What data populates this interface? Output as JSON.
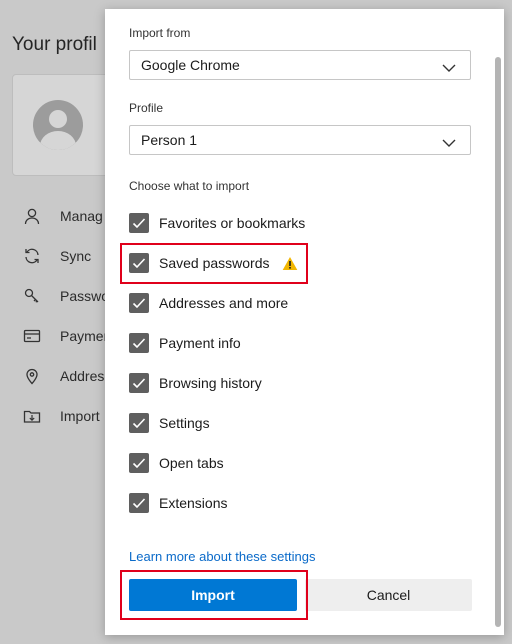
{
  "background": {
    "title": "Your profil",
    "nav_items": [
      {
        "label": "Manag",
        "icon": "person-icon"
      },
      {
        "label": "Sync",
        "icon": "sync-icon"
      },
      {
        "label": "Passwo",
        "icon": "key-icon"
      },
      {
        "label": "Paymen",
        "icon": "card-icon"
      },
      {
        "label": "Addres",
        "icon": "location-icon"
      },
      {
        "label": "Import",
        "icon": "import-icon"
      }
    ]
  },
  "dialog": {
    "import_from_label": "Import from",
    "import_from_value": "Google Chrome",
    "profile_label": "Profile",
    "profile_value": "Person 1",
    "choose_label": "Choose what to import",
    "items": [
      {
        "label": "Favorites or bookmarks",
        "checked": true
      },
      {
        "label": "Saved passwords",
        "checked": true,
        "warning": true
      },
      {
        "label": "Addresses and more",
        "checked": true
      },
      {
        "label": "Payment info",
        "checked": true
      },
      {
        "label": "Browsing history",
        "checked": true
      },
      {
        "label": "Settings",
        "checked": true
      },
      {
        "label": "Open tabs",
        "checked": true
      },
      {
        "label": "Extensions",
        "checked": true
      }
    ],
    "learn_more": "Learn more about these settings",
    "import_button": "Import",
    "cancel_button": "Cancel"
  },
  "colors": {
    "accent": "#0078d4",
    "highlight": "#e0001b",
    "warning": "#f2b600",
    "checkbox": "#5f5f5f"
  }
}
